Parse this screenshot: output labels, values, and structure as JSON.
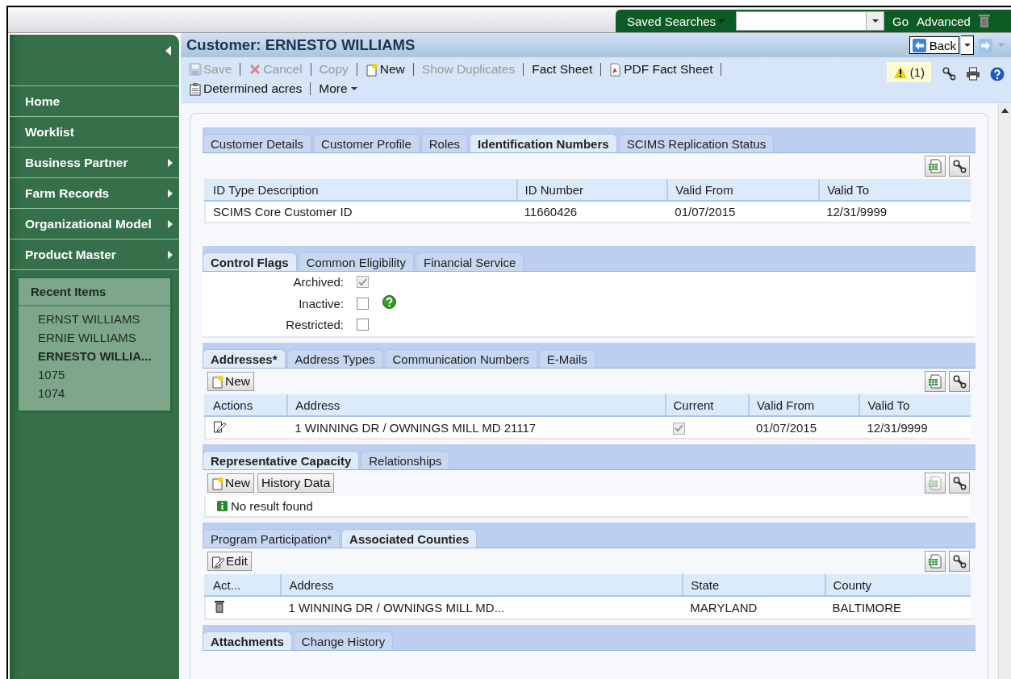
{
  "header": {
    "saved_searches": "Saved Searches",
    "go": "Go",
    "advanced": "Advanced"
  },
  "sidebar": {
    "items": [
      {
        "label": "Home",
        "submenu": false
      },
      {
        "label": "Worklist",
        "submenu": false
      },
      {
        "label": "Business Partner",
        "submenu": true
      },
      {
        "label": "Farm Records",
        "submenu": true
      },
      {
        "label": "Organizational Model",
        "submenu": true
      },
      {
        "label": "Product Master",
        "submenu": true
      }
    ],
    "recent": {
      "title": "Recent Items",
      "items": [
        {
          "label": "ERNST WILLIAMS",
          "selected": false
        },
        {
          "label": "ERNIE WILLIAMS",
          "selected": false
        },
        {
          "label": "ERNESTO WILLIA...",
          "selected": true
        },
        {
          "label": "1075",
          "selected": false
        },
        {
          "label": "1074",
          "selected": false
        }
      ]
    }
  },
  "page": {
    "title": "Customer: ERNESTO WILLIAMS",
    "back": "Back",
    "warning": "(1)",
    "toolbar_rows": [
      [
        {
          "label": "Save",
          "kind": "save",
          "disabled": true
        },
        {
          "label": "Cancel",
          "kind": "cancel",
          "disabled": true
        },
        {
          "label": "Copy",
          "kind": "plain",
          "disabled": true
        },
        {
          "label": "New",
          "kind": "new",
          "disabled": false
        },
        {
          "label": "Show Duplicates",
          "kind": "plain",
          "disabled": true
        },
        {
          "label": "Fact Sheet",
          "kind": "plain",
          "disabled": false
        },
        {
          "label": "PDF Fact Sheet",
          "kind": "pdf",
          "disabled": false
        }
      ],
      [
        {
          "label": "Determined acres",
          "kind": "clipboard",
          "disabled": false
        },
        {
          "label": "More",
          "kind": "menu",
          "disabled": false
        }
      ]
    ]
  },
  "blocks": [
    {
      "tabs": [
        {
          "label": "Customer Details",
          "selected": false
        },
        {
          "label": "Customer Profile",
          "selected": false
        },
        {
          "label": "Roles",
          "selected": false
        },
        {
          "label": "Identification Numbers",
          "selected": true
        },
        {
          "label": "SCIMS Replication Status",
          "selected": false
        }
      ],
      "tools": {
        "export_disabled": false
      },
      "content": {
        "kind": "table",
        "columns": [
          "ID Type Description",
          "ID Number",
          "Valid From",
          "Valid To"
        ],
        "rows": [
          [
            "SCIMS Core Customer ID",
            "11660426",
            "01/07/2015",
            "12/31/9999"
          ]
        ]
      }
    },
    {
      "tabs": [
        {
          "label": "Control Flags",
          "selected": true
        },
        {
          "label": "Common Eligibility",
          "selected": false
        },
        {
          "label": "Financial Service",
          "selected": false
        }
      ],
      "content": {
        "kind": "flags",
        "flags": [
          {
            "label": "Archived:",
            "checked": true,
            "disabled": true,
            "help": false
          },
          {
            "label": "Inactive:",
            "checked": false,
            "disabled": false,
            "help": true
          },
          {
            "label": "Restricted:",
            "checked": false,
            "disabled": false,
            "help": false
          }
        ]
      }
    },
    {
      "tabs": [
        {
          "label": "Addresses*",
          "selected": true
        },
        {
          "label": "Address Types",
          "selected": false
        },
        {
          "label": "Communication Numbers",
          "selected": false
        },
        {
          "label": "E-Mails",
          "selected": false
        }
      ],
      "buttons": [
        {
          "label": "New",
          "kind": "new"
        }
      ],
      "tools": {
        "export_disabled": false
      },
      "content": {
        "kind": "table",
        "columns": [
          "Actions",
          "Address",
          "Current",
          "Valid From",
          "Valid To"
        ],
        "rows": [
          [
            {
              "kind": "edit"
            },
            "1 WINNING DR / OWNINGS MILL MD 21117",
            {
              "kind": "checkbox",
              "checked": true
            },
            "01/07/2015",
            "12/31/9999"
          ]
        ]
      }
    },
    {
      "tabs": [
        {
          "label": "Representative Capacity",
          "selected": true
        },
        {
          "label": "Relationships",
          "selected": false
        }
      ],
      "buttons": [
        {
          "label": "New",
          "kind": "new"
        },
        {
          "label": "History Data",
          "kind": "plain"
        }
      ],
      "tools": {
        "export_disabled": true
      },
      "content": {
        "kind": "message",
        "text": "No result found"
      }
    },
    {
      "tabs": [
        {
          "label": "Program Participation*",
          "selected": false
        },
        {
          "label": "Associated Counties",
          "selected": true
        }
      ],
      "buttons": [
        {
          "label": "Edit",
          "kind": "edit"
        }
      ],
      "tools": {
        "export_disabled": false
      },
      "content": {
        "kind": "table",
        "columns": [
          "Act...",
          "Address",
          "State",
          "County"
        ],
        "rows": [
          [
            {
              "kind": "delete"
            },
            "1 WINNING DR / OWNINGS MILL MD...",
            "MARYLAND",
            "BALTIMORE"
          ]
        ]
      }
    },
    {
      "tabs": [
        {
          "label": "Attachments",
          "selected": true
        },
        {
          "label": "Change History",
          "selected": false
        }
      ]
    }
  ]
}
